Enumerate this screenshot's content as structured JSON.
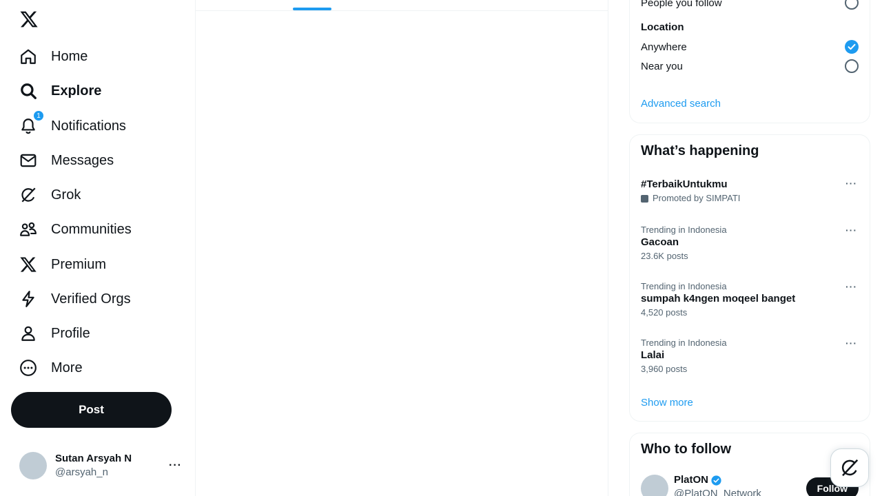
{
  "nav": {
    "items": [
      {
        "label": "Home",
        "icon": "home-icon"
      },
      {
        "label": "Explore",
        "icon": "search-icon"
      },
      {
        "label": "Notifications",
        "icon": "bell-icon",
        "badge": "1"
      },
      {
        "label": "Messages",
        "icon": "mail-icon"
      },
      {
        "label": "Grok",
        "icon": "grok-icon"
      },
      {
        "label": "Communities",
        "icon": "people-icon"
      },
      {
        "label": "Premium",
        "icon": "x-logo-icon"
      },
      {
        "label": "Verified Orgs",
        "icon": "lightning-icon"
      },
      {
        "label": "Profile",
        "icon": "person-icon"
      },
      {
        "label": "More",
        "icon": "more-circle-icon"
      }
    ],
    "post_label": "Post"
  },
  "account": {
    "name": "Sutan Arsyah N",
    "handle": "@arsyah_n"
  },
  "search_filters": {
    "people_option": "People you follow",
    "location_heading": "Location",
    "location_options": [
      {
        "label": "Anywhere",
        "checked": true
      },
      {
        "label": "Near you",
        "checked": false
      }
    ],
    "advanced_link": "Advanced search"
  },
  "trends": {
    "title": "What’s happening",
    "items": [
      {
        "name": "#TerbaikUntukmu",
        "promoted": "Promoted by SIMPATI"
      },
      {
        "context": "Trending in Indonesia",
        "name": "Gacoan",
        "count": "23.6K posts"
      },
      {
        "context": "Trending in Indonesia",
        "name": "sumpah k4ngen moqeel banget",
        "count": "4,520 posts"
      },
      {
        "context": "Trending in Indonesia",
        "name": "Lalai",
        "count": "3,960 posts"
      }
    ],
    "show_more": "Show more"
  },
  "who_to_follow": {
    "title": "Who to follow",
    "items": [
      {
        "name": "PlatON",
        "handle": "@PlatON_Network",
        "verified": true,
        "button": "Follow"
      }
    ]
  },
  "colors": {
    "accent": "#1d9bf0",
    "text": "#0f1419",
    "muted": "#536471",
    "border": "#eff3f4"
  }
}
